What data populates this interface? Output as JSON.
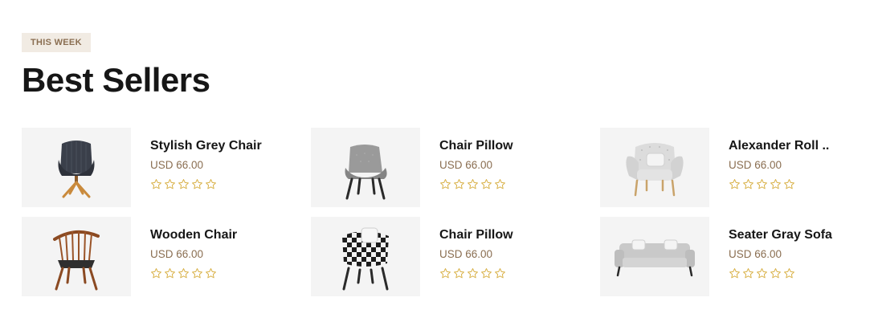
{
  "section": {
    "eyebrow": "THIS WEEK",
    "title": "Best Sellers"
  },
  "colors": {
    "eyebrow_bg": "#f1ebe3",
    "accent": "#8a6e51",
    "star": "#d9b24a",
    "thumb_bg": "#f4f4f4"
  },
  "products": [
    {
      "name": "Stylish Grey Chair",
      "price": "USD 66.00",
      "rating": 0,
      "image": "dark-swivel-chair"
    },
    {
      "name": "Chair Pillow",
      "price": "USD 66.00",
      "rating": 0,
      "image": "grey-armchair"
    },
    {
      "name": "Alexander Roll ..",
      "price": "USD 66.00",
      "rating": 0,
      "image": "tufted-armchair"
    },
    {
      "name": "Wooden Chair",
      "price": "USD 66.00",
      "rating": 0,
      "image": "wooden-spindle-chair"
    },
    {
      "name": "Chair Pillow",
      "price": "USD 66.00",
      "rating": 0,
      "image": "checkered-chair"
    },
    {
      "name": "Seater Gray Sofa",
      "price": "USD 66.00",
      "rating": 0,
      "image": "grey-sofa"
    }
  ]
}
